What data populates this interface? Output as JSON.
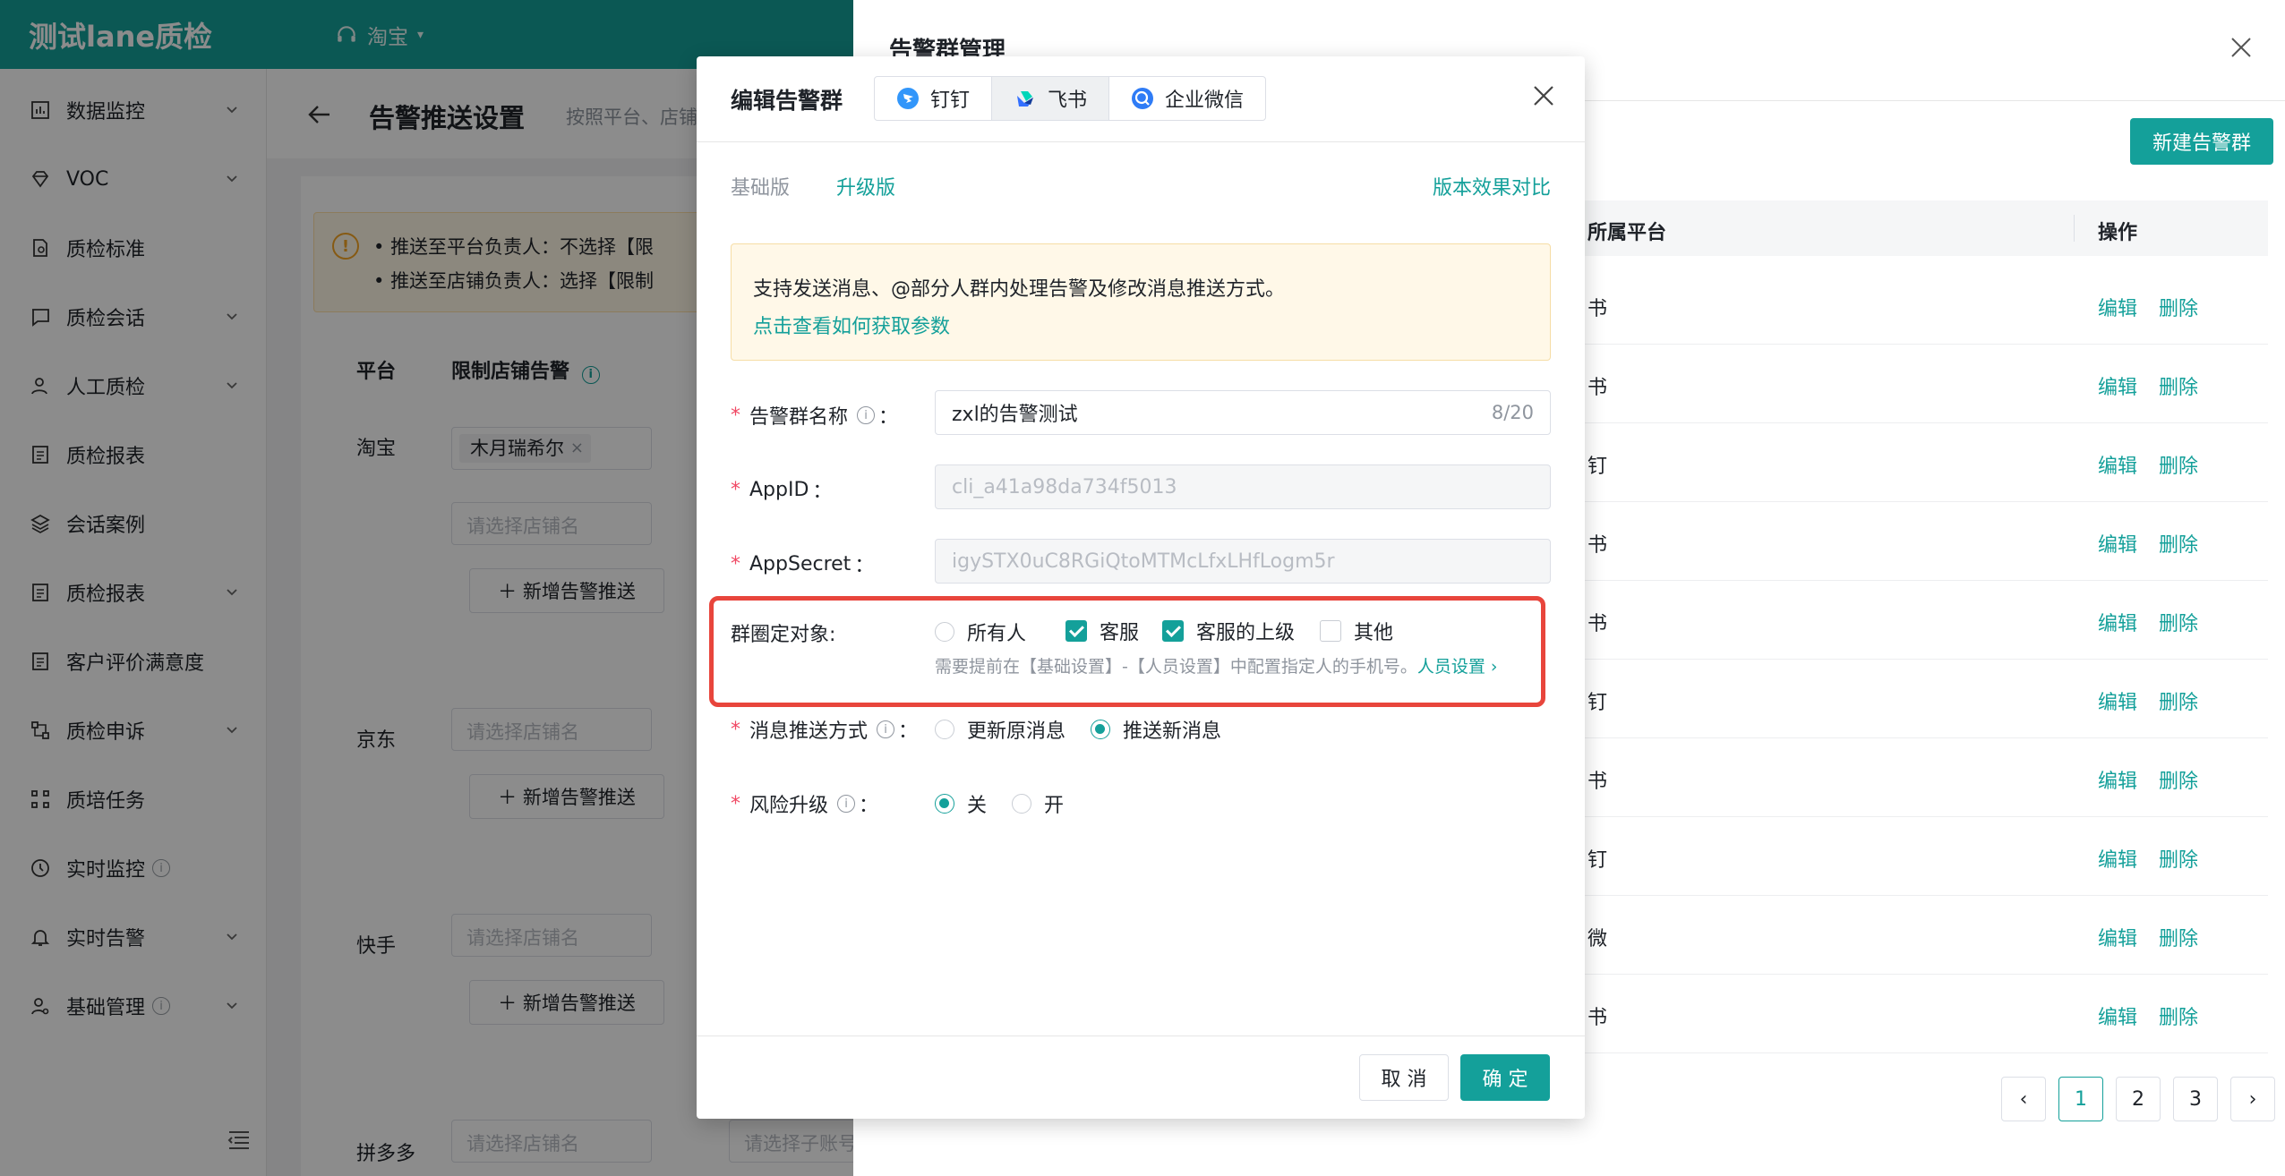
{
  "app": {
    "brand": "测试lane质检",
    "store": "淘宝"
  },
  "sidebar": {
    "items": [
      {
        "label": "数据监控",
        "icon": "bar-chart-icon",
        "expandable": true
      },
      {
        "label": "VOC",
        "icon": "diamond-icon",
        "expandable": true
      },
      {
        "label": "质检标准",
        "icon": "document-search-icon",
        "expandable": false
      },
      {
        "label": "质检会话",
        "icon": "chat-icon",
        "expandable": true
      },
      {
        "label": "人工质检",
        "icon": "user-icon",
        "expandable": true
      },
      {
        "label": "质检报表",
        "icon": "report-icon",
        "expandable": false
      },
      {
        "label": "会话案例",
        "icon": "layers-icon",
        "expandable": false
      },
      {
        "label": "质检报表",
        "icon": "report-icon",
        "expandable": true
      },
      {
        "label": "客户评价满意度",
        "icon": "report-icon",
        "expandable": false
      },
      {
        "label": "质检申诉",
        "icon": "appeal-icon",
        "expandable": true
      },
      {
        "label": "质培任务",
        "icon": "task-icon",
        "expandable": false
      },
      {
        "label": "实时监控",
        "icon": "clock-icon",
        "expandable": false,
        "tip": true
      },
      {
        "label": "实时告警",
        "icon": "bell-icon",
        "expandable": true
      },
      {
        "label": "基础管理",
        "icon": "user-settings-icon",
        "expandable": true,
        "tip": true
      }
    ]
  },
  "page": {
    "title": "告警推送设置",
    "subtitle": "按照平台、店铺",
    "alert_lines": [
      "推送至平台负责人：不选择【限",
      "推送至店铺负责人：选择【限制"
    ],
    "columns": {
      "platform": "平台",
      "limit_store": "限制店铺告警"
    },
    "platforms": [
      "淘宝",
      "京东",
      "快手",
      "拼多多"
    ],
    "tag": "木月瑞希尔",
    "store_placeholder": "请选择店铺名",
    "add_push": "新增告警推送",
    "sub_account_placeholder": "请选择子账号"
  },
  "drawer": {
    "title": "告警群管理",
    "new_button": "新建告警群",
    "columns": {
      "platform": "所属平台",
      "action": "操作"
    },
    "rows": [
      "书",
      "书",
      "钉",
      "书",
      "书",
      "钉",
      "书",
      "钉",
      "微",
      "书"
    ],
    "edit": "编辑",
    "delete": "删除",
    "pages": [
      "1",
      "2",
      "3"
    ]
  },
  "modal": {
    "title": "编辑告警群",
    "platform_tabs": [
      {
        "label": "钉钉",
        "icon": "dingtalk-icon"
      },
      {
        "label": "飞书",
        "icon": "feishu-icon"
      },
      {
        "label": "企业微信",
        "icon": "wecom-icon"
      }
    ],
    "active_platform": "飞书",
    "version_tabs": [
      "基础版",
      "升级版"
    ],
    "active_version": "升级版",
    "compare_link": "版本效果对比",
    "notice_text": "支持发送消息、@部分人群内处理告警及修改消息推送方式。",
    "notice_link": "点击查看如何获取参数",
    "fields": {
      "name": {
        "label": "告警群名称",
        "value": "zxl的告警测试",
        "count": "8/20"
      },
      "appid": {
        "label": "AppID",
        "value": "cli_a41a98da734f5013"
      },
      "appsecret": {
        "label": "AppSecret",
        "value": "igySTX0uC8RGiQtoMTMcLfxLHfLogm5r"
      }
    },
    "mention": {
      "label": "群圈定对象:",
      "options": [
        {
          "label": "所有人",
          "checked": false
        },
        {
          "label": "客服",
          "checked": true
        },
        {
          "label": "客服的上级",
          "checked": true
        },
        {
          "label": "其他",
          "checked": false
        }
      ],
      "hint": "需要提前在【基础设置】-【人员设置】中配置指定人的手机号。",
      "hint_link": "人员设置"
    },
    "push_mode": {
      "label": "消息推送方式",
      "options": [
        "更新原消息",
        "推送新消息"
      ],
      "selected": "推送新消息"
    },
    "risk_upgrade": {
      "label": "风险升级",
      "options": [
        "关",
        "开"
      ],
      "selected": "关"
    },
    "cancel": "取 消",
    "ok": "确 定"
  },
  "colors": {
    "primary": "#14a09a",
    "danger": "#e8453c",
    "warning_bg": "#fff8e8"
  }
}
